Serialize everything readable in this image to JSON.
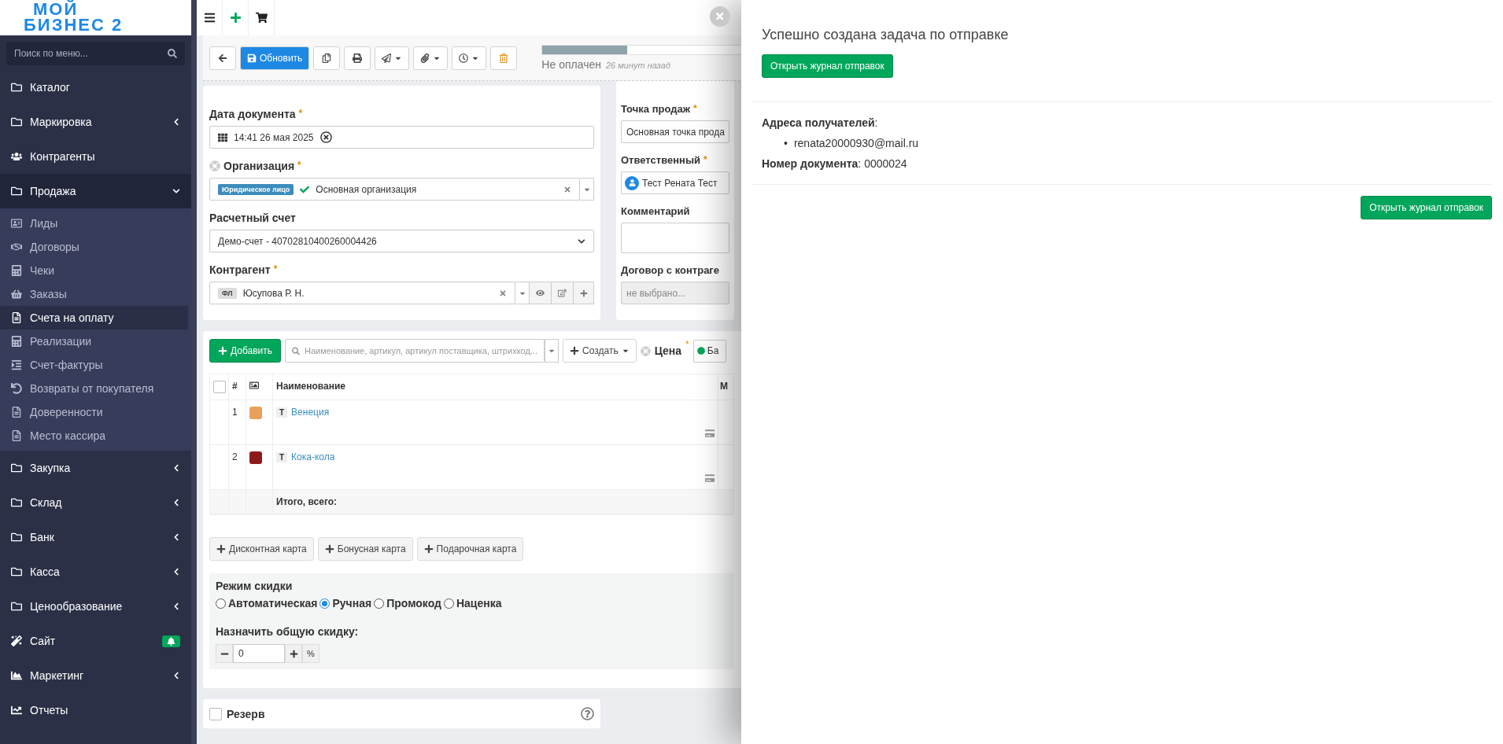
{
  "logo": {
    "line1": "МОЙ",
    "line2": "БИЗНЕС 2"
  },
  "sidebar": {
    "search_placeholder": "Поиск по меню...",
    "items": [
      {
        "label": "Каталог",
        "has_submenu": false,
        "expanded": false,
        "badge": false
      },
      {
        "label": "Маркировка",
        "has_submenu": true,
        "expanded": false,
        "badge": false
      },
      {
        "label": "Контрагенты",
        "has_submenu": false,
        "expanded": false,
        "badge": false
      },
      {
        "label": "Продажа",
        "has_submenu": true,
        "expanded": true,
        "badge": false,
        "children": [
          {
            "label": "Лиды",
            "selected": false
          },
          {
            "label": "Договоры",
            "selected": false
          },
          {
            "label": "Чеки",
            "selected": false
          },
          {
            "label": "Заказы",
            "selected": false
          },
          {
            "label": "Счета на оплату",
            "selected": true
          },
          {
            "label": "Реализации",
            "selected": false
          },
          {
            "label": "Счет-фактуры",
            "selected": false
          },
          {
            "label": "Возвраты от покупателя",
            "selected": false
          },
          {
            "label": "Доверенности",
            "selected": false
          },
          {
            "label": "Место кассира",
            "selected": false
          }
        ]
      },
      {
        "label": "Закупка",
        "has_submenu": true,
        "expanded": false,
        "badge": false
      },
      {
        "label": "Склад",
        "has_submenu": true,
        "expanded": false,
        "badge": false
      },
      {
        "label": "Банк",
        "has_submenu": true,
        "expanded": false,
        "badge": false
      },
      {
        "label": "Касса",
        "has_submenu": true,
        "expanded": false,
        "badge": false
      },
      {
        "label": "Ценообразование",
        "has_submenu": true,
        "expanded": false,
        "badge": false
      },
      {
        "label": "Сайт",
        "has_submenu": false,
        "expanded": false,
        "badge": true
      },
      {
        "label": "Маркетинг",
        "has_submenu": true,
        "expanded": false,
        "badge": false
      },
      {
        "label": "Отчеты",
        "has_submenu": false,
        "expanded": false,
        "badge": false
      }
    ]
  },
  "toolbar": {
    "primary_button": "Обновить",
    "status": {
      "label": "Не оплачен",
      "time": "26 минут назад",
      "level": 0.36
    }
  },
  "form_left": [
    {
      "kind": "date",
      "label": "Дата документа",
      "required_mark": "*",
      "value": "14:41 26 мая 2025"
    },
    {
      "kind": "org",
      "label": "Организация",
      "required_mark": "*",
      "tag": "Юридическое лицо",
      "value": "Основная организация"
    },
    {
      "kind": "select",
      "label": "Расчетный счет",
      "value": "Демо-счет - 40702810400260004426"
    },
    {
      "kind": "contractor",
      "label": "Контрагент",
      "required_mark": "*",
      "tag": "ФЛ",
      "value": "Юсупова Р. Н."
    }
  ],
  "form_right": [
    {
      "kind": "text",
      "label": "Точка продаж",
      "required_mark": "*",
      "value": "Основная точка прода"
    },
    {
      "kind": "user",
      "label": "Ответственный",
      "required_mark": "*",
      "value": "Тест Рената Тест"
    },
    {
      "kind": "textarea",
      "label": "Комментарий"
    },
    {
      "kind": "disabled",
      "label": "Договор с контраге",
      "placeholder": "не выбрано..."
    }
  ],
  "products": {
    "add_button": "Добавить",
    "search_placeholder": "Наименование, артикул, артикул поставщика, штрихкод...",
    "create_button": "Создать",
    "price_label": "Цена",
    "price_required_mark": "*",
    "price_value": "Ба",
    "select_all_checked": false,
    "columns": [
      "#",
      "Наименование",
      "М"
    ],
    "rows": [
      {
        "number": "1",
        "type": "Т",
        "name": "Венеция"
      },
      {
        "number": "2",
        "type": "Т",
        "name": "Кока-кола"
      }
    ],
    "total_label": "Итого, всего:",
    "card_buttons": [
      "Дисконтная карта",
      "Бонусная карта",
      "Подарочная карта"
    ],
    "discount": {
      "title": "Режим скидки",
      "modes": [
        {
          "label": "Автоматическая",
          "selected": false
        },
        {
          "label": "Ручная",
          "selected": true
        },
        {
          "label": "Промокод",
          "selected": false
        },
        {
          "label": "Наценка",
          "selected": false
        }
      ],
      "assign_label": "Назначить общую скидку:",
      "value": "0",
      "unit": "%"
    }
  },
  "reserve": {
    "label": "Резерв",
    "checked": false
  },
  "panel": {
    "title": "Успешно создана задача по отправке",
    "top_button": "Открыть журнал отправок",
    "recipients_label": "**Адреса получателей**:",
    "bullet": "•",
    "recipients": [
      "renata20000930@mail.ru"
    ],
    "document_number": "**Номер документа**: 0000024",
    "bottom_button": "Открыть журнал отправок"
  }
}
